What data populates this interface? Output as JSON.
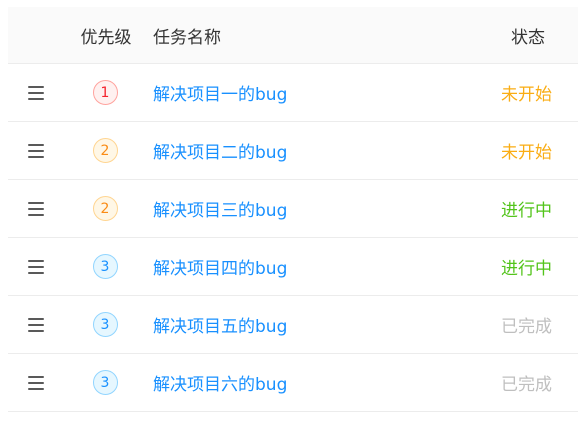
{
  "header": {
    "priority": "优先级",
    "name": "任务名称",
    "status": "状态"
  },
  "rows": [
    {
      "priority": "1",
      "priority_level": 1,
      "name": "解决项目一的bug",
      "status": "未开始",
      "status_kind": "not-started"
    },
    {
      "priority": "2",
      "priority_level": 2,
      "name": "解决项目二的bug",
      "status": "未开始",
      "status_kind": "not-started"
    },
    {
      "priority": "2",
      "priority_level": 2,
      "name": "解决项目三的bug",
      "status": "进行中",
      "status_kind": "in-progress"
    },
    {
      "priority": "3",
      "priority_level": 3,
      "name": "解决项目四的bug",
      "status": "进行中",
      "status_kind": "in-progress"
    },
    {
      "priority": "3",
      "priority_level": 3,
      "name": "解决项目五的bug",
      "status": "已完成",
      "status_kind": "done"
    },
    {
      "priority": "3",
      "priority_level": 3,
      "name": "解决项目六的bug",
      "status": "已完成",
      "status_kind": "done"
    }
  ],
  "icons": {
    "drag_handle": "drag-handle-icon"
  },
  "colors": {
    "link": "#1890ff",
    "not_started": "#faad14",
    "in_progress": "#52c41a",
    "done": "#bfbfbf",
    "priority_1": "#f5222d",
    "priority_2": "#fa8c16",
    "priority_3": "#1890ff"
  }
}
